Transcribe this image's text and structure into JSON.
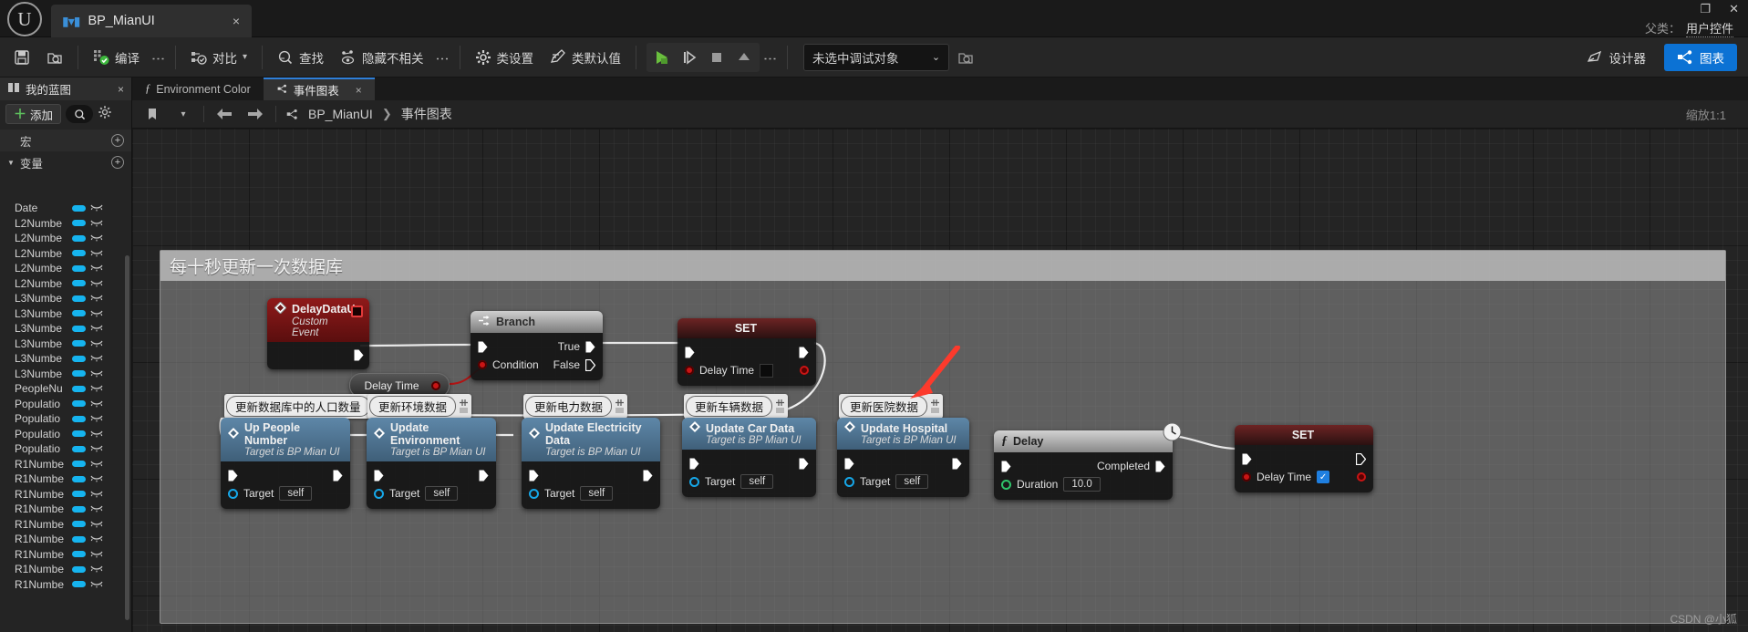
{
  "window": {
    "logo_icon": "unreal-logo-icon",
    "document_tab": {
      "label": "BP_MianUI",
      "icon": "blueprint-icon",
      "close": "×"
    },
    "controls": {
      "restore": "❐",
      "close": "✕"
    },
    "parent_class": {
      "label": "父类：",
      "value": "用户控件"
    }
  },
  "toolbar": {
    "save_label": "",
    "buttons": [
      {
        "name": "save",
        "icon": "save-icon",
        "label": ""
      },
      {
        "name": "browse",
        "icon": "browse-content-icon",
        "label": ""
      },
      {
        "name": "compile",
        "icon": "compile-icon",
        "label": "编译"
      },
      {
        "name": "diff",
        "icon": "diff-icon",
        "label": "对比"
      },
      {
        "name": "find",
        "icon": "search-icon",
        "label": "查找"
      },
      {
        "name": "hide-unrelated",
        "icon": "hide-unrelated-icon",
        "label": "隐藏不相关"
      },
      {
        "name": "class-settings",
        "icon": "gear-icon",
        "label": "类设置"
      },
      {
        "name": "class-defaults",
        "icon": "class-defaults-icon",
        "label": "类默认值"
      }
    ],
    "play_controls": [
      {
        "name": "play",
        "icon": "play-icon"
      },
      {
        "name": "step",
        "icon": "step-icon"
      },
      {
        "name": "stop",
        "icon": "stop-icon"
      },
      {
        "name": "eject",
        "icon": "eject-icon"
      }
    ],
    "debug_object": {
      "value": "未选中调试对象",
      "caret": "⌄"
    },
    "debug_browse_icon": "browse-debug-icon",
    "modes": [
      {
        "name": "designer",
        "label": "设计器",
        "icon": "designer-icon",
        "active": false
      },
      {
        "name": "graph",
        "label": "图表",
        "icon": "graph-icon",
        "active": true
      }
    ]
  },
  "left_panel": {
    "tab": {
      "label": "我的蓝图",
      "icon": "book-icon",
      "close": "×"
    },
    "add_button": {
      "label": "添加",
      "plus": "＋"
    },
    "search_icon": "search-icon",
    "settings_icon": "gear-icon",
    "sections": [
      {
        "label": "宏",
        "expanded": false,
        "add": "+"
      },
      {
        "label": "变量",
        "expanded": true,
        "add": "+"
      }
    ],
    "variables": [
      "Date",
      "L2Numbe",
      "L2Numbe",
      "L2Numbe",
      "L2Numbe",
      "L2Numbe",
      "L3Numbe",
      "L3Numbe",
      "L3Numbe",
      "L3Numbe",
      "L3Numbe",
      "L3Numbe",
      "PeopleNu",
      "Populatio",
      "Populatio",
      "Populatio",
      "Populatio",
      "R1Numbe",
      "R1Numbe",
      "R1Numbe",
      "R1Numbe",
      "R1Numbe",
      "R1Numbe",
      "R1Numbe",
      "R1Numbe",
      "R1Numbe"
    ]
  },
  "graph": {
    "tabs": [
      {
        "label": "Environment Color",
        "icon": "function-icon",
        "active": false,
        "close": ""
      },
      {
        "label": "事件图表",
        "icon": "graph-icon",
        "active": true,
        "close": "×"
      }
    ],
    "breadcrumb": {
      "root": "BP_MianUI",
      "arrow": "❯",
      "leaf": "事件图表"
    },
    "nav": {
      "bookmark_icon": "bookmark-icon",
      "caret_icon": "chevron-down-icon",
      "back_icon": "arrow-left-icon",
      "forward_icon": "arrow-right-icon",
      "graph_icon": "graph-icon"
    },
    "zoom_label": "缩放1:1",
    "comment_box": {
      "title": "每十秒更新一次数据库"
    },
    "watermark": "CSDN @小狐",
    "nodes": [
      {
        "name": "delay-data-up-event",
        "title": "DelayDataUp",
        "subtitle": "Custom Event",
        "kind": "event",
        "pins": []
      },
      {
        "name": "branch-node",
        "title": "Branch",
        "kind": "branch",
        "out_true": "True",
        "out_false": "False",
        "in_condition": "Condition"
      },
      {
        "name": "set-delay-time-node-1",
        "title": "SET",
        "kind": "set",
        "property": "Delay Time",
        "value": ""
      },
      {
        "name": "get-delay-time-node",
        "title": "Delay Time",
        "kind": "getter"
      },
      {
        "name": "up-people-number-node",
        "title": "Up People Number",
        "subtitle": "Target is BP Mian UI",
        "kind": "function",
        "target_label": "Target",
        "target_value": "self",
        "bubble": "更新数据库中的人口数量"
      },
      {
        "name": "update-environment-node",
        "title": "Update Environment",
        "subtitle": "Target is BP Mian UI",
        "kind": "function",
        "target_label": "Target",
        "target_value": "self",
        "bubble": "更新环境数据"
      },
      {
        "name": "update-electricity-data-node",
        "title": "Update Electricity Data",
        "subtitle": "Target is BP Mian UI",
        "kind": "function",
        "target_label": "Target",
        "target_value": "self",
        "bubble": "更新电力数据"
      },
      {
        "name": "update-car-data-node",
        "title": "Update Car Data",
        "subtitle": "Target is BP Mian UI",
        "kind": "function",
        "target_label": "Target",
        "target_value": "self",
        "bubble": "更新车辆数据"
      },
      {
        "name": "update-hospital-node",
        "title": "Update Hospital",
        "subtitle": "Target is BP Mian UI",
        "kind": "function",
        "target_label": "Target",
        "target_value": "self",
        "bubble": "更新医院数据"
      },
      {
        "name": "delay-node",
        "title": "Delay",
        "kind": "latent",
        "out_label": "Completed",
        "duration_label": "Duration",
        "duration_value": "10.0",
        "clock_icon": "clock-icon",
        "f_icon": "function-icon"
      },
      {
        "name": "set-delay-time-node-2",
        "title": "SET",
        "kind": "set",
        "property": "Delay Time",
        "value": "checked"
      }
    ]
  },
  "colors": {
    "accent_blue": "#0c72d4",
    "event_red": "#8f1a1a",
    "function_blue": "#5e87a8",
    "variable_cyan": "#16b4ef",
    "exec_white": "#ffffff",
    "bool_red": "#c81515",
    "object_blue": "#16a7e8",
    "annotation_red": "#ff3b30"
  }
}
